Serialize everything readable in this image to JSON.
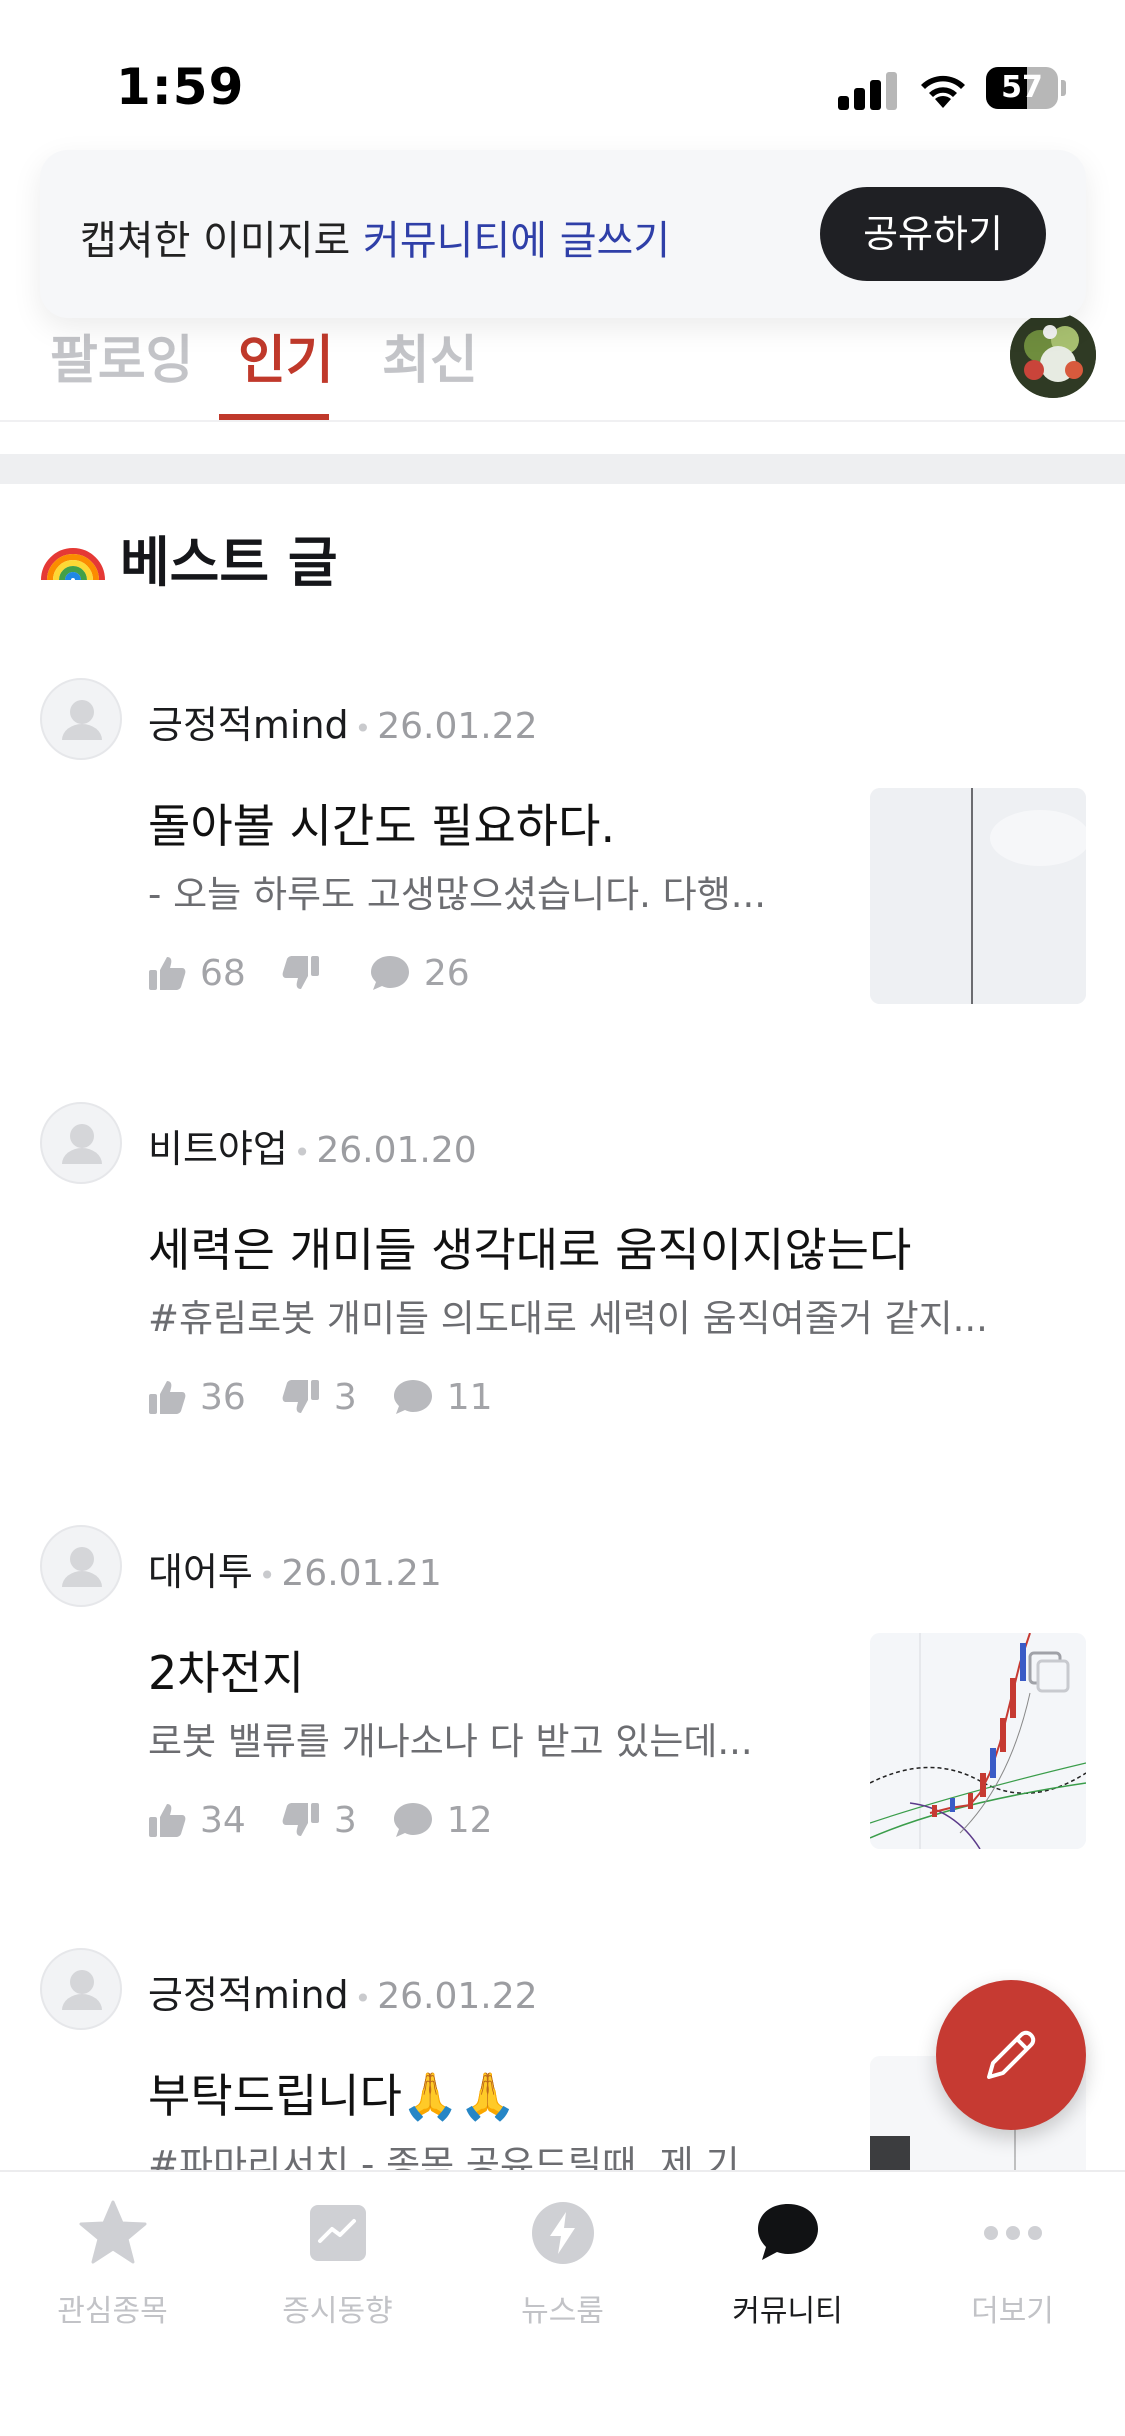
{
  "status_bar": {
    "time": "1:59",
    "battery": "57",
    "battery_level": 0.57
  },
  "share_banner": {
    "text_prefix": "캡쳐한 이미지로 ",
    "text_accent": "커뮤니티에 글쓰기",
    "button_label": "공유하기"
  },
  "tabs": [
    {
      "label": "팔로잉",
      "active": false
    },
    {
      "label": "인기",
      "active": true
    },
    {
      "label": "최신",
      "active": false
    }
  ],
  "best_section": {
    "title": "베스트 글",
    "icon": "rainbow-icon"
  },
  "posts": [
    {
      "author": "긍정적mind",
      "date": "26.01.22",
      "title": "돌아볼 시간도 필요하다.",
      "snippet": "- 오늘 하루도 고생많으셨습니다. 다행...",
      "likes": "68",
      "dislikes": "",
      "comments": "26",
      "has_thumbnail": true
    },
    {
      "author": "비트야업",
      "date": "26.01.20",
      "title": "세력은 개미들 생각대로 움직이지않는다",
      "snippet": "#휴림로봇 개미들 의도대로 세력이 움직여줄거 같지...",
      "likes": "36",
      "dislikes": "3",
      "comments": "11",
      "has_thumbnail": false
    },
    {
      "author": "대어투",
      "date": "26.01.21",
      "title": "2차전지",
      "snippet": "로봇 밸류를 개나소나 다 받고 있는데...",
      "likes": "34",
      "dislikes": "3",
      "comments": "12",
      "has_thumbnail": true
    },
    {
      "author": "긍정적mind",
      "date": "26.01.22",
      "title": "부탁드립니다🙏🙏",
      "snippet": "#파마리서치 - 종목 공유드릴때, 제 기",
      "likes": "",
      "dislikes": "",
      "comments": "",
      "has_thumbnail": true
    }
  ],
  "fab": {
    "icon": "pencil-icon"
  },
  "bottom_nav": [
    {
      "label": "관심종목",
      "icon": "star-icon",
      "active": false
    },
    {
      "label": "증시동향",
      "icon": "chart-icon",
      "active": false
    },
    {
      "label": "뉴스룸",
      "icon": "lightning-icon",
      "active": false
    },
    {
      "label": "커뮤니티",
      "icon": "chat-bubble-icon",
      "active": true
    },
    {
      "label": "더보기",
      "icon": "more-icon",
      "active": false
    }
  ],
  "colors": {
    "accent_red": "#c0392b",
    "link_blue": "#2f3fa8",
    "muted": "#a3a4a8"
  }
}
